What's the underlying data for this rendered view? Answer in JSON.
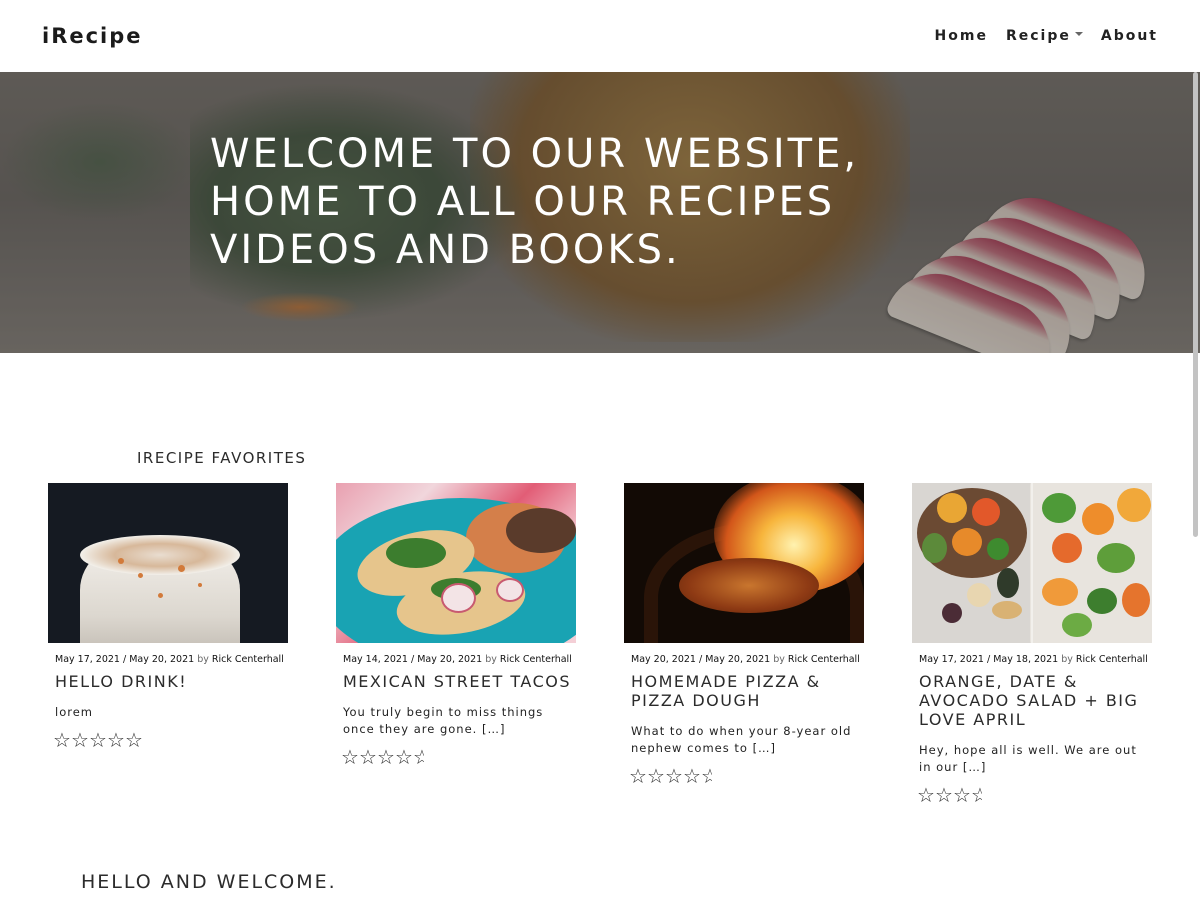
{
  "nav": {
    "brand": "iRecipe",
    "items": [
      {
        "label": "Home"
      },
      {
        "label": "Recipe",
        "dropdown": true
      },
      {
        "label": "About"
      }
    ]
  },
  "hero": {
    "title": "WELCOME TO OUR WEBSITE, HOME TO ALL OUR RECIPES VIDEOS AND BOOKS."
  },
  "favorites": {
    "title": "IRECIPE FAVORITES",
    "cards": [
      {
        "published": "May 17, 2021",
        "updated": "May 20, 2021",
        "by": "by",
        "author": "Rick Centerhall",
        "title": "HELLO DRINK!",
        "excerpt": "lorem",
        "rating": 0
      },
      {
        "published": "May 14, 2021",
        "updated": "May 20, 2021",
        "by": "by",
        "author": "Rick Centerhall",
        "title": "MEXICAN STREET TACOS",
        "excerpt": "You truly begin to miss things once they are gone. […]",
        "rating": 4.5
      },
      {
        "published": "May 20, 2021",
        "updated": "May 20, 2021",
        "by": "by",
        "author": "Rick Centerhall",
        "title": "HOMEMADE PIZZA & PIZZA DOUGH",
        "excerpt": "What to do when your 8-year old nephew comes to […]",
        "rating": 4.5
      },
      {
        "published": "May 17, 2021",
        "updated": "May 18, 2021",
        "by": "by",
        "author": "Rick Centerhall",
        "title": "ORANGE, DATE & AVOCADO SALAD + BIG LOVE APRIL",
        "excerpt": "Hey, hope all is well. We are out in our […]",
        "rating": 3.5
      }
    ]
  },
  "welcome": {
    "title": "HELLO AND WELCOME."
  },
  "icons": {
    "star": "star-outline-icon",
    "half_star": "star-half-icon",
    "caret": "chevron-down-icon"
  }
}
